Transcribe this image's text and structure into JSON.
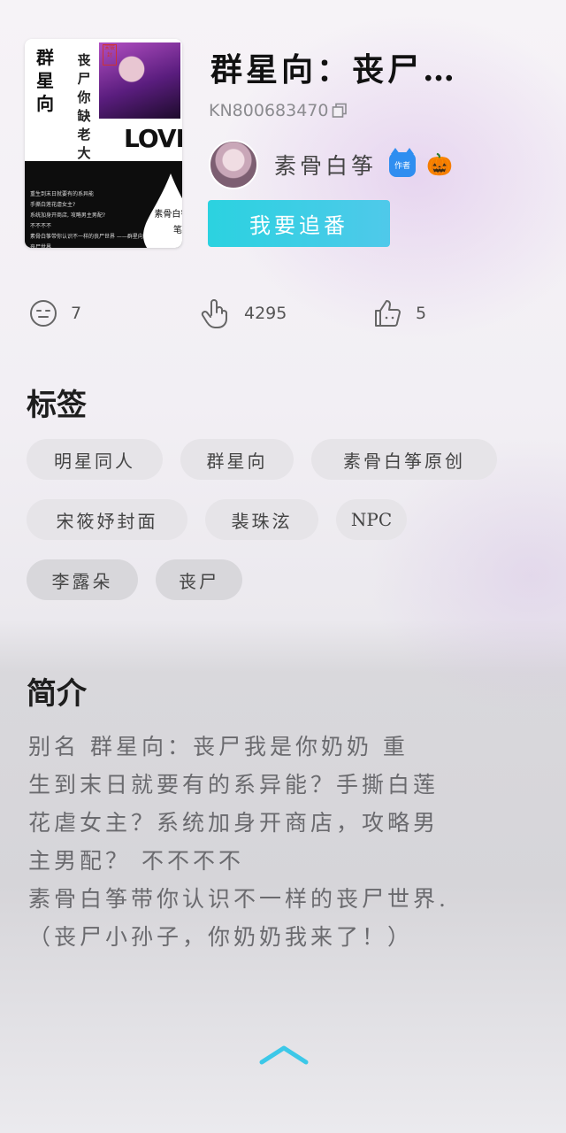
{
  "book": {
    "title": "群星向：丧尸…",
    "id": "KN800683470",
    "cover": {
      "big_text": "群星向",
      "sub_text": "丧尸你缺老大",
      "stamp": "宋筱封",
      "love": "LOVE",
      "author_text": "素骨白筝 执笔",
      "blurb_lines": [
        "重生到末日就要有的系异能",
        "手撕白莲花虐女主?",
        "系统加身开商店, 攻略男主男配?",
        "不不不不",
        "素骨白筝带你认识不一样的丧尸世界 ——群星向丧尸世界"
      ]
    }
  },
  "author": {
    "name": "素骨白筝",
    "badge": "作者",
    "emoji": "🎃"
  },
  "follow_button": "我要追番",
  "stats": {
    "comments": "7",
    "clicks": "4295",
    "likes": "5"
  },
  "tags_section": {
    "title": "标签",
    "tags": [
      "明星同人",
      "群星向",
      "素骨白筝原创",
      "宋筱妤封面",
      "裴珠泫",
      "NPC",
      "李露朵",
      "丧尸"
    ]
  },
  "intro_section": {
    "title": "简介",
    "lines": [
      "别名 群星向：丧尸我是你奶奶   重",
      "生到末日就要有的系异能？手撕白莲",
      "花虐女主？系统加身开商店，攻略男",
      "主男配？              不不不不",
      "素骨白筝带你认识不一样的丧尸世界.",
      "（丧尸小孙子，你奶奶我来了！）"
    ]
  },
  "colors": {
    "follow_button": "#2bd2e0",
    "tag_bg": "#e6e4e8",
    "chevron": "#3cc8e8"
  }
}
